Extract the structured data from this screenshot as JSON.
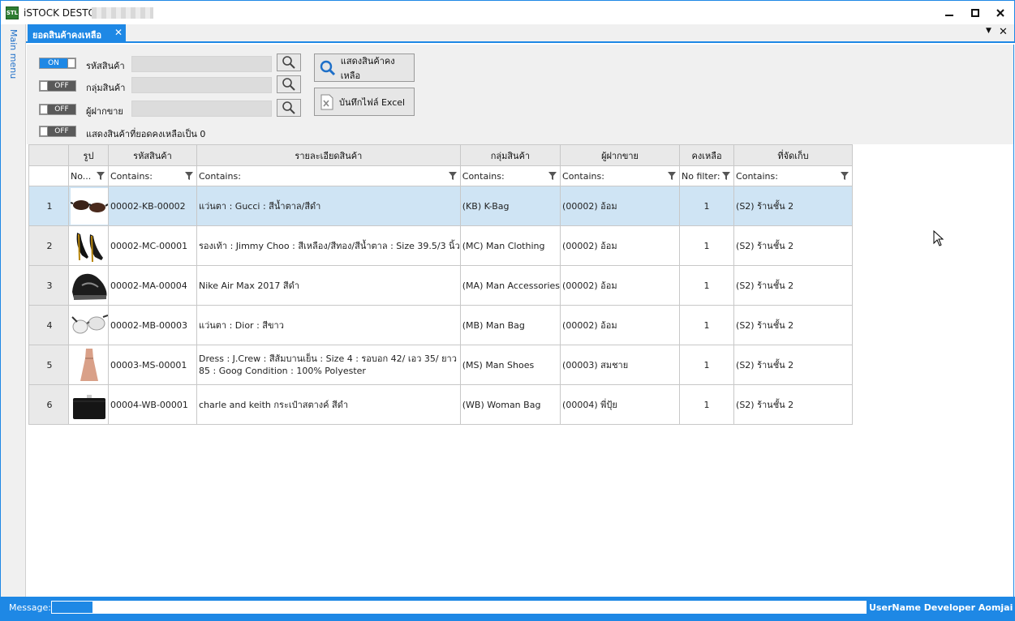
{
  "window": {
    "app_logo": "STL",
    "title": "iSTOCK DESTOP",
    "minimize_icon": "minimize-icon",
    "maximize_icon": "maximize-icon",
    "close_icon": "close-icon"
  },
  "sidebar": {
    "label": "Main menu"
  },
  "tabs": [
    {
      "label": "ยอดสินค้าคงเหลือ",
      "close": "✕"
    }
  ],
  "tab_overflow": {
    "menu": "▼",
    "close": "✕"
  },
  "filters": [
    {
      "toggle": "ON",
      "label": "รหัสสินค้า",
      "value": ""
    },
    {
      "toggle": "OFF",
      "label": "กลุ่มสินค้า",
      "value": ""
    },
    {
      "toggle": "OFF",
      "label": "ผู้ฝากขาย",
      "value": ""
    },
    {
      "toggle": "OFF",
      "label": "แสดงสินค้าที่ยอดคงเหลือเป็น 0"
    }
  ],
  "buttons": {
    "show_stock": "แสดงสินค้าคงเหลือ",
    "export_excel": "บันทึกไฟล์ Excel"
  },
  "grid": {
    "columns": [
      "รูป",
      "รหัสสินค้า",
      "รายละเอียดสินค้า",
      "กลุ่มสินค้า",
      "ผู้ฝากขาย",
      "คงเหลือ",
      "ที่จัดเก็บ"
    ],
    "filters": [
      "No...",
      "Contains:",
      "Contains:",
      "Contains:",
      "Contains:",
      "No filter:",
      "Contains:"
    ],
    "rows": [
      {
        "no": "1",
        "image": "sunglasses-image",
        "code": "00002-KB-00002",
        "desc": "แว่นตา : Gucci : สีน้ำตาล/สีดำ",
        "group": "(KB) K-Bag",
        "consignor": "(00002) อ้อม",
        "qty": "1",
        "location": "(S2) ร้านชั้น 2"
      },
      {
        "no": "2",
        "image": "heels-image",
        "code": "00002-MC-00001",
        "desc": "รองเท้า : Jimmy Choo : สีเหลือง/สีทอง/สีน้ำตาล : Size 39.5/3 นิ้ว",
        "group": "(MC) Man Clothing",
        "consignor": "(00002) อ้อม",
        "qty": "1",
        "location": "(S2) ร้านชั้น 2"
      },
      {
        "no": "3",
        "image": "sneaker-image",
        "code": "00002-MA-00004",
        "desc": "Nike Air Max 2017  สีดำ",
        "group": "(MA) Man Accessories",
        "consignor": "(00002) อ้อม",
        "qty": "1",
        "location": "(S2) ร้านชั้น 2"
      },
      {
        "no": "4",
        "image": "white-sunglasses-image",
        "code": "00002-MB-00003",
        "desc": "แว่นตา : Dior : สีขาว",
        "group": "(MB) Man Bag",
        "consignor": "(00002) อ้อม",
        "qty": "1",
        "location": "(S2) ร้านชั้น 2"
      },
      {
        "no": "5",
        "image": "dress-image",
        "code": "00003-MS-00001",
        "desc": "Dress : J.Crew : สีส้มบานเย็น : Size 4 : รอบอก  42/ เอว 35/ ยาว 85 : Goog Condition : 100% Polyester",
        "group": "(MS) Man Shoes",
        "consignor": "(00003) สมชาย",
        "qty": "1",
        "location": "(S2) ร้านชั้น 2"
      },
      {
        "no": "6",
        "image": "wallet-image",
        "code": "00004-WB-00001",
        "desc": "charle and keith กระเป๋าสตางค์ สีดำ",
        "group": "(WB) Woman Bag",
        "consignor": "(00004) พี่ปุ้ย",
        "qty": "1",
        "location": "(S2) ร้านชั้น 2"
      }
    ]
  },
  "status": {
    "message_label": "Message:",
    "progress": 0.05,
    "user": "UserName Developer Aomjai"
  },
  "colors": {
    "accent": "#1e88e5",
    "selected_row": "#cfe4f4",
    "header_bg": "#e9e9e9"
  }
}
